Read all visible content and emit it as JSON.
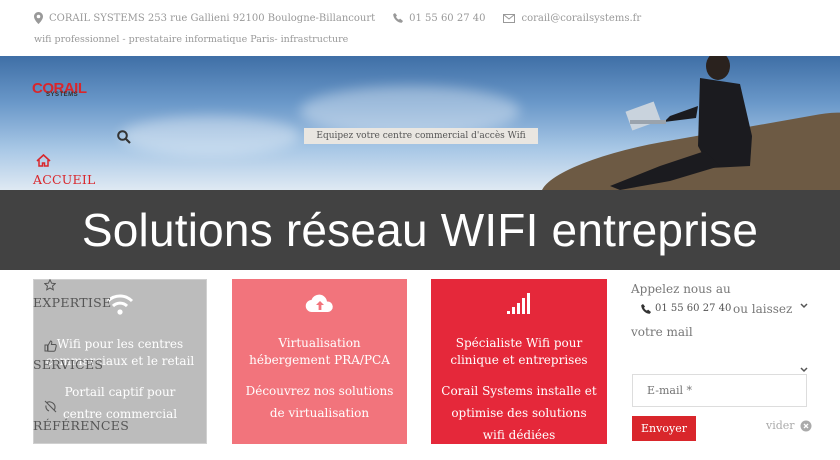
{
  "header": {
    "address": "CORAIL SYSTEMS 253 rue Gallieni 92100 Boulogne-Billancourt",
    "phone": "01 55 60 27 40",
    "email": "corail@corailsystems.fr",
    "tagline": "wifi professionnel - prestataire informatique Paris- infrastructure"
  },
  "logo": {
    "main": "CORAIL",
    "sub": "SYSTEMS"
  },
  "hero": {
    "caption": "Equipez votre centre commercial d'accès Wifi"
  },
  "banner": {
    "title": "Solutions réseau WIFI entreprise"
  },
  "nav": {
    "accueil": "ACCUEIL",
    "expertise": "EXPERTISE",
    "services": "SERVICES",
    "references": "RÉFÉRENCES"
  },
  "cards": [
    {
      "title": "Wifi pour les centres commerciaux et le retail",
      "desc": "Portail captif pour centre commercial",
      "icon": "wifi-icon"
    },
    {
      "title": "Virtualisation hébergement PRA/PCA",
      "desc": "Découvrez nos solutions de virtualisation",
      "icon": "cloud-upload-icon"
    },
    {
      "title": "Spécialiste Wifi pour clinique et entreprises",
      "desc": "Corail Systems installe et optimise des solutions wifi dédiées",
      "icon": "signal-bars-icon"
    }
  ],
  "sidebar": {
    "call_prefix": "Appelez nous au",
    "phone": "01 55 60 27 40",
    "call_suffix": "ou laissez votre mail",
    "email_placeholder": "E-mail *",
    "send_label": "Envoyer",
    "clear_label": "vider"
  },
  "colors": {
    "brand": "#d9262b",
    "card_gray": "#bcbcbc",
    "card_pink": "#f2747c",
    "card_red": "#e5283a"
  }
}
